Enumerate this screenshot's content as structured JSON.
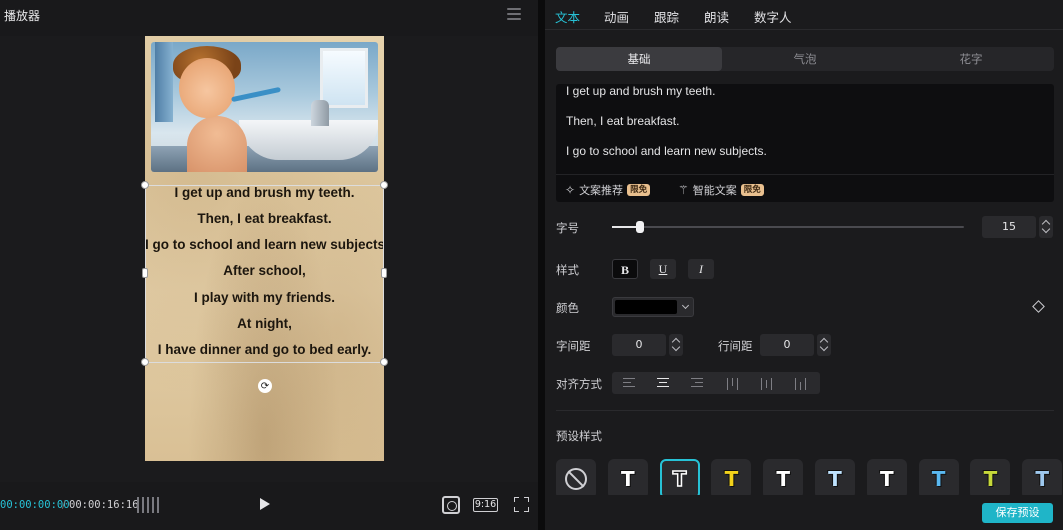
{
  "player": {
    "title": "播放器",
    "time_current": "00:00:00:00",
    "time_separator": "/",
    "time_total": "00:00:16:16",
    "ratio_label": "9:16",
    "story_lines": [
      "I get up and brush my teeth.",
      "Then, I eat breakfast.",
      "I go to school and learn new subjects.",
      "After school,",
      "I play with my friends.",
      "At night,",
      "I have dinner and go to bed early."
    ]
  },
  "panel": {
    "tabs": [
      "文本",
      "动画",
      "跟踪",
      "朗读",
      "数字人"
    ],
    "active_tab": "文本",
    "subtabs": [
      "基础",
      "气泡",
      "花字"
    ],
    "active_subtab": "基础",
    "text_content": [
      "I get up and brush my teeth.",
      "Then, I eat breakfast.",
      " I go to school and learn new subjects."
    ],
    "tools": {
      "recommend_label": "文案推荐",
      "smart_label": "智能文案",
      "free_badge": "限免"
    },
    "font_size": {
      "label": "字号",
      "value": "15",
      "fraction": 0.04
    },
    "style": {
      "label": "样式",
      "bold": "B",
      "underline": "U",
      "italic": "I"
    },
    "color": {
      "label": "颜色",
      "value": "#000000"
    },
    "letter_spacing": {
      "label": "字间距",
      "value": "0"
    },
    "line_spacing": {
      "label": "行间距",
      "value": "0"
    },
    "alignment": {
      "label": "对齐方式",
      "active": "center"
    },
    "presets": {
      "label": "预设样式",
      "colors": [
        "none",
        "#ffffff",
        "#ffffff",
        "#f2d21b",
        "#ffffff",
        "#bfe3ff",
        "#ffffff",
        "#5ab8f0",
        "#c6d83a",
        "#9ec8ee"
      ]
    },
    "save_preset_label": "保存预设"
  },
  "accent_color": "#27c2d6"
}
